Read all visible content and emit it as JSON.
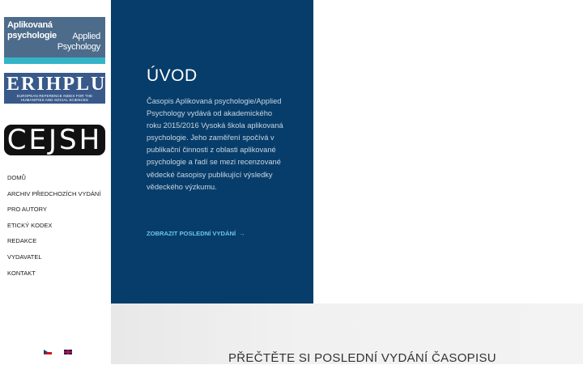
{
  "sidebar": {
    "logo_ap": {
      "cz_line1": "Aplikovaná",
      "cz_line2": "psychologie",
      "en_line1": "Applied",
      "en_line2": "Psychology"
    },
    "logo_erih": {
      "big": "ERIHPLUS",
      "small": "EUROPEAN REFERENCE INDEX FOR THE HUMANITIES AND SOCIAL SCIENCES"
    },
    "logo_cejsh": {
      "text": "CEJSH"
    },
    "nav": [
      {
        "label": "DOMŮ"
      },
      {
        "label": "ARCHIV PŘEDCHOZÍCH VYDÁNÍ"
      },
      {
        "label": "PRO AUTORY"
      },
      {
        "label": "ETICKÝ KODEX"
      },
      {
        "label": "REDAKCE"
      },
      {
        "label": "VYDAVATEL"
      },
      {
        "label": "KONTAKT"
      }
    ],
    "languages": [
      {
        "code": "cs",
        "icon": "czech-flag-icon"
      },
      {
        "code": "en",
        "icon": "uk-flag-icon"
      }
    ]
  },
  "hero": {
    "title": "ÚVOD",
    "text": "Časopis Aplikovaná psychologie/Applied Psychology vydává od akademického roku 2015/2016 Vysoká škola aplikovaná psychologie. Jeho zaměření spočívá v publikační činnosti z oblasti aplikované psychologie a řadí se mezi recenzované vědecké časopisy publikující výsledky vědeckého výzkumu.",
    "cta_label": "ZOBRAZIT POSLEDNÍ VYDÁNÍ",
    "cta_arrow": "→"
  },
  "latest": {
    "heading": "PŘEČTĚTE SI POSLEDNÍ VYDÁNÍ ČASOPISU"
  },
  "colors": {
    "hero_bg": "#073d6a",
    "cta": "#6fc4ee",
    "band_bg": "#f1f1f1"
  }
}
